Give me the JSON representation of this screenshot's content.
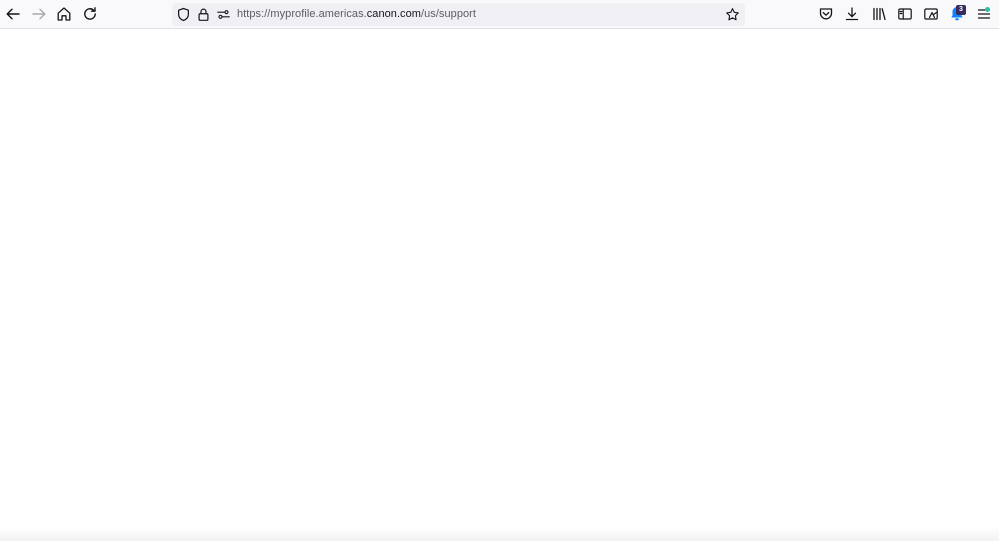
{
  "browser": {
    "url_prefix": "https://myprofile.americas.",
    "url_host": "canon.com",
    "url_path": "/us/support",
    "extension_badge_count": "3",
    "icons": {
      "back": "back-arrow-icon",
      "forward": "forward-arrow-icon",
      "home": "home-icon",
      "reload": "reload-icon",
      "tracking_protection": "shield-icon",
      "site_security": "lock-icon",
      "permissions": "permissions-icon",
      "bookmark": "star-icon",
      "pocket": "pocket-icon",
      "downloads": "download-icon",
      "library": "library-icon",
      "sidebar": "sidebar-icon",
      "screenshot": "screenshot-icon",
      "extension": "extension-icon",
      "menu": "hamburger-menu-icon"
    },
    "colors": {
      "toolbar_bg": "#f9f9fb",
      "urlbar_bg": "#f0f0f4",
      "icon": "#15141a",
      "disabled_icon": "#a8a8b0",
      "extension_accent": "#0a84ff",
      "badge_bg": "#3b2a5c",
      "menu_dot": "#2ac3a2"
    }
  }
}
